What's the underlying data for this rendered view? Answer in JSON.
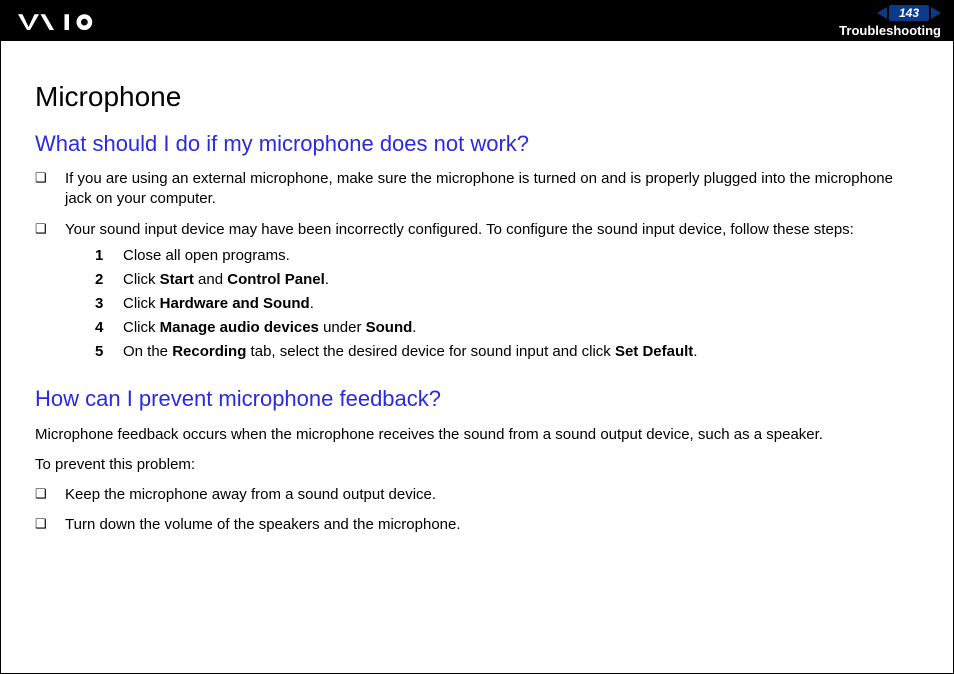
{
  "header": {
    "page_number": "143",
    "section": "Troubleshooting"
  },
  "content": {
    "title": "Microphone",
    "q1": {
      "heading": "What should I do if my microphone does not work?",
      "bullets": [
        "If you are using an external microphone, make sure the microphone is turned on and is properly plugged into the microphone jack on your computer.",
        "Your sound input device may have been incorrectly configured. To configure the sound input device, follow these steps:"
      ],
      "steps": [
        {
          "n": "1",
          "pre": "Close all open programs."
        },
        {
          "n": "2",
          "pre": "Click ",
          "b1": "Start",
          "mid": " and ",
          "b2": "Control Panel",
          "post": "."
        },
        {
          "n": "3",
          "pre": "Click ",
          "b1": "Hardware and Sound",
          "post": "."
        },
        {
          "n": "4",
          "pre": "Click ",
          "b1": "Manage audio devices",
          "mid": " under ",
          "b2": "Sound",
          "post": "."
        },
        {
          "n": "5",
          "pre": "On the ",
          "b1": "Recording",
          "mid": " tab, select the desired device for sound input and click ",
          "b2": "Set Default",
          "post": "."
        }
      ]
    },
    "q2": {
      "heading": "How can I prevent microphone feedback?",
      "para1": "Microphone feedback occurs when the microphone receives the sound from a sound output device, such as a speaker.",
      "para2": "To prevent this problem:",
      "bullets": [
        "Keep the microphone away from a sound output device.",
        "Turn down the volume of the speakers and the microphone."
      ]
    }
  }
}
